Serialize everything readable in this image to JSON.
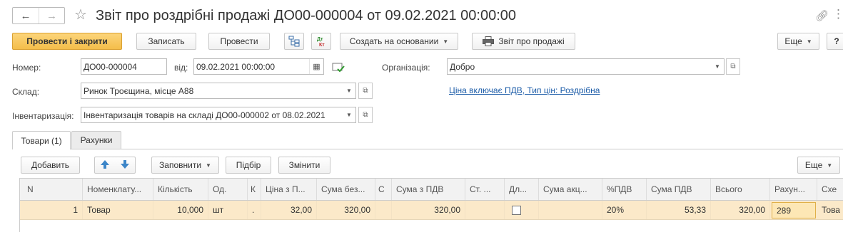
{
  "header": {
    "back_icon": "arrow-left-icon",
    "forward_icon": "arrow-right-icon",
    "favorite_icon": "star-icon",
    "title": "Звіт про роздрібні продажі ДО00-000004 от 09.02.2021 00:00:00",
    "link_icon": "link-icon",
    "more_icon": "more-icon"
  },
  "toolbar": {
    "post_and_close": "Провести і закрити",
    "save": "Записать",
    "post": "Провести",
    "structure_icon": "document-structure-icon",
    "dt_kt_icon": "dt-kt-icon",
    "create_based_on": "Создать на основании",
    "sales_report": "Звіт про продажі",
    "more": "Еще",
    "help": "?"
  },
  "form": {
    "number_label": "Номер:",
    "number_value": "ДО00-000004",
    "date_label": "від:",
    "date_value": "09.02.2021 00:00:00",
    "organization_label": "Організація:",
    "organization_value": "Добро",
    "warehouse_label": "Склад:",
    "warehouse_value": "Ринок Троєщина, місце А88",
    "price_link": "Ціна включає ПДВ, Тип цін: Роздрібна",
    "inventory_label": "Інвентаризація:",
    "inventory_value": "Інвентаризація товарів на складі ДО00-000002 от 08.02.2021"
  },
  "tabs": [
    {
      "label": "Товари (1)",
      "active": true
    },
    {
      "label": "Рахунки",
      "active": false
    }
  ],
  "table_toolbar": {
    "add": "Добавить",
    "fill": "Заповнити",
    "select": "Підбір",
    "change": "Змінити",
    "more": "Еще"
  },
  "table": {
    "columns": [
      "N",
      "Номенклату...",
      "Кількість",
      "Од.",
      "К",
      "Ціна з П...",
      "Сума без...",
      "С",
      "Сума з ПДВ",
      "Ст. ...",
      "Дл...",
      "Сума акц...",
      "%ПДВ",
      "Сума ПДВ",
      "Всього",
      "Рахун...",
      "Схе"
    ],
    "rows": [
      {
        "n": "1",
        "item": "Товар",
        "qty": "10,000",
        "unit": "шт",
        "k": ".",
        "price": "32,00",
        "sum_no_vat": "320,00",
        "c": "",
        "sum_with_vat": "320,00",
        "st": "",
        "dl_checked": false,
        "excise": "",
        "vat_rate": "20%",
        "vat_sum": "53,33",
        "total": "320,00",
        "account": "289",
        "scheme": "Това"
      }
    ]
  }
}
